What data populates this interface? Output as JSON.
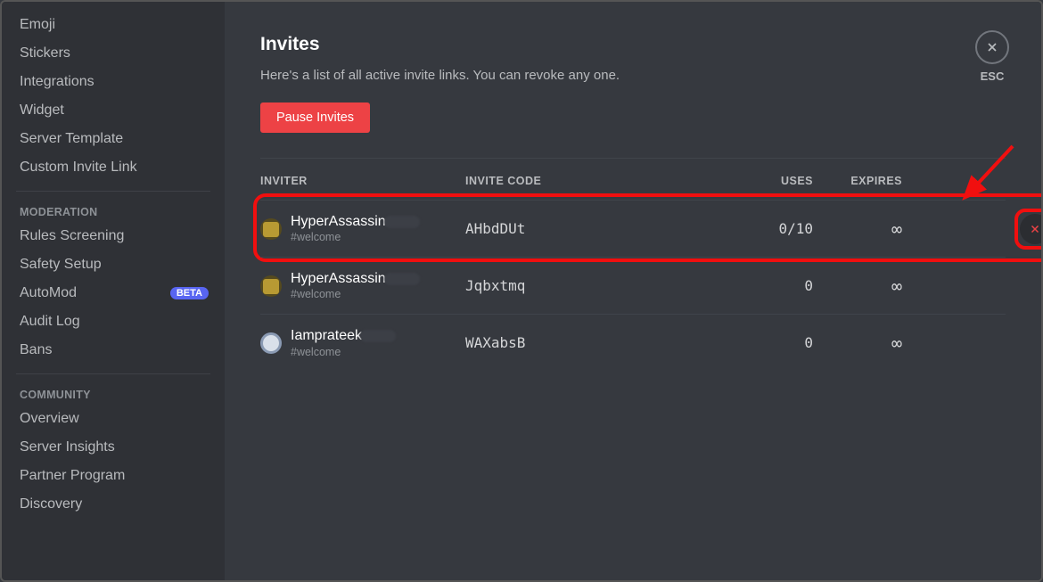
{
  "sidebar": {
    "items_top": [
      {
        "label": "Emoji"
      },
      {
        "label": "Stickers"
      },
      {
        "label": "Integrations"
      },
      {
        "label": "Widget"
      },
      {
        "label": "Server Template"
      },
      {
        "label": "Custom Invite Link"
      }
    ],
    "section_moderation": "MODERATION",
    "items_moderation": [
      {
        "label": "Rules Screening"
      },
      {
        "label": "Safety Setup"
      },
      {
        "label": "AutoMod",
        "badge": "BETA"
      },
      {
        "label": "Audit Log"
      },
      {
        "label": "Bans"
      }
    ],
    "section_community": "COMMUNITY",
    "items_community": [
      {
        "label": "Overview"
      },
      {
        "label": "Server Insights"
      },
      {
        "label": "Partner Program"
      },
      {
        "label": "Discovery"
      }
    ]
  },
  "page": {
    "title": "Invites",
    "description": "Here's a list of all active invite links. You can revoke any one.",
    "pause_button": "Pause Invites",
    "esc_label": "ESC"
  },
  "columns": {
    "inviter": "INVITER",
    "code": "INVITE CODE",
    "uses": "USES",
    "expires": "EXPIRES"
  },
  "invites": [
    {
      "name": "HyperAssassin",
      "channel": "#welcome",
      "code": "AHbdDUt",
      "uses": "0/10",
      "expires": "∞",
      "highlighted": true,
      "avatar": "dark"
    },
    {
      "name": "HyperAssassin",
      "channel": "#welcome",
      "code": "Jqbxtmq",
      "uses": "0",
      "expires": "∞",
      "highlighted": false,
      "avatar": "dark"
    },
    {
      "name": "Iamprateek",
      "channel": "#welcome",
      "code": "WAXabsB",
      "uses": "0",
      "expires": "∞",
      "highlighted": false,
      "avatar": "light"
    }
  ],
  "annotation": {
    "arrow_color": "#f10f0f"
  }
}
